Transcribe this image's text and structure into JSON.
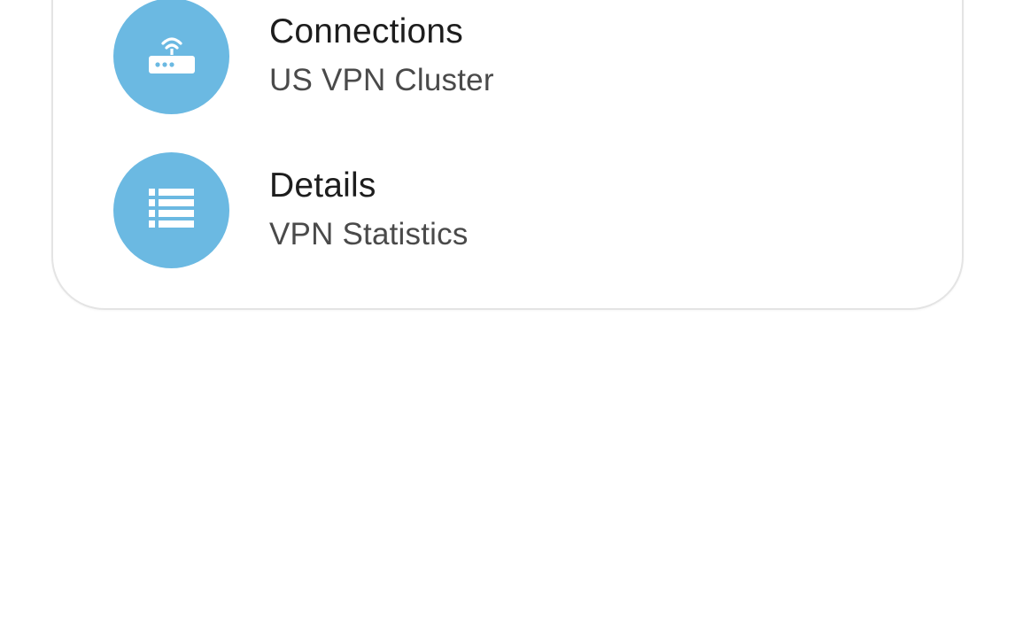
{
  "menu": {
    "items": [
      {
        "title": "Connections",
        "subtitle": "US VPN Cluster",
        "icon": "router-wifi-icon"
      },
      {
        "title": "Details",
        "subtitle": "VPN Statistics",
        "icon": "list-icon"
      }
    ]
  },
  "colors": {
    "icon_background": "#6bb9e2",
    "title_text": "#1d1d1d",
    "subtitle_text": "#4a4a4a",
    "card_border": "#e4e4e4",
    "page_background": "#ffffff"
  }
}
